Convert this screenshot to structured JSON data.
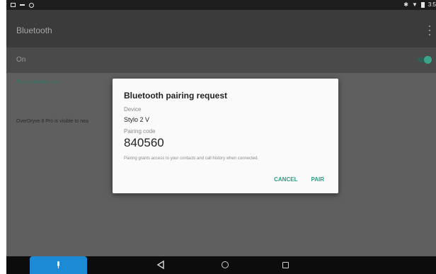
{
  "statusbar": {
    "time": "3:5",
    "icons": [
      "screenshot-icon",
      "message-icon",
      "android-icon",
      "bluetooth-icon",
      "wifi-icon",
      "battery-icon"
    ]
  },
  "appbar": {
    "title": "Bluetooth"
  },
  "toggle": {
    "label": "On",
    "state": "on"
  },
  "section": {
    "header": "Available devices",
    "visible_text": "OverDryve 8 Pro is visible to nea"
  },
  "dialog": {
    "title": "Bluetooth pairing request",
    "device_label": "Device",
    "device_name": "Stylo 2 V",
    "code_label": "Pairing code",
    "code": "840560",
    "note": "Pairing grants access to your contacts and call history when connected.",
    "cancel": "CANCEL",
    "pair": "PAIR"
  },
  "navbar": {
    "icons": [
      "mic-icon",
      "back-icon",
      "home-icon",
      "recents-icon"
    ]
  },
  "colors": {
    "accent": "#2a9d84",
    "switch_on": "#3aa58a",
    "mic_button": "#1d8ad6"
  }
}
